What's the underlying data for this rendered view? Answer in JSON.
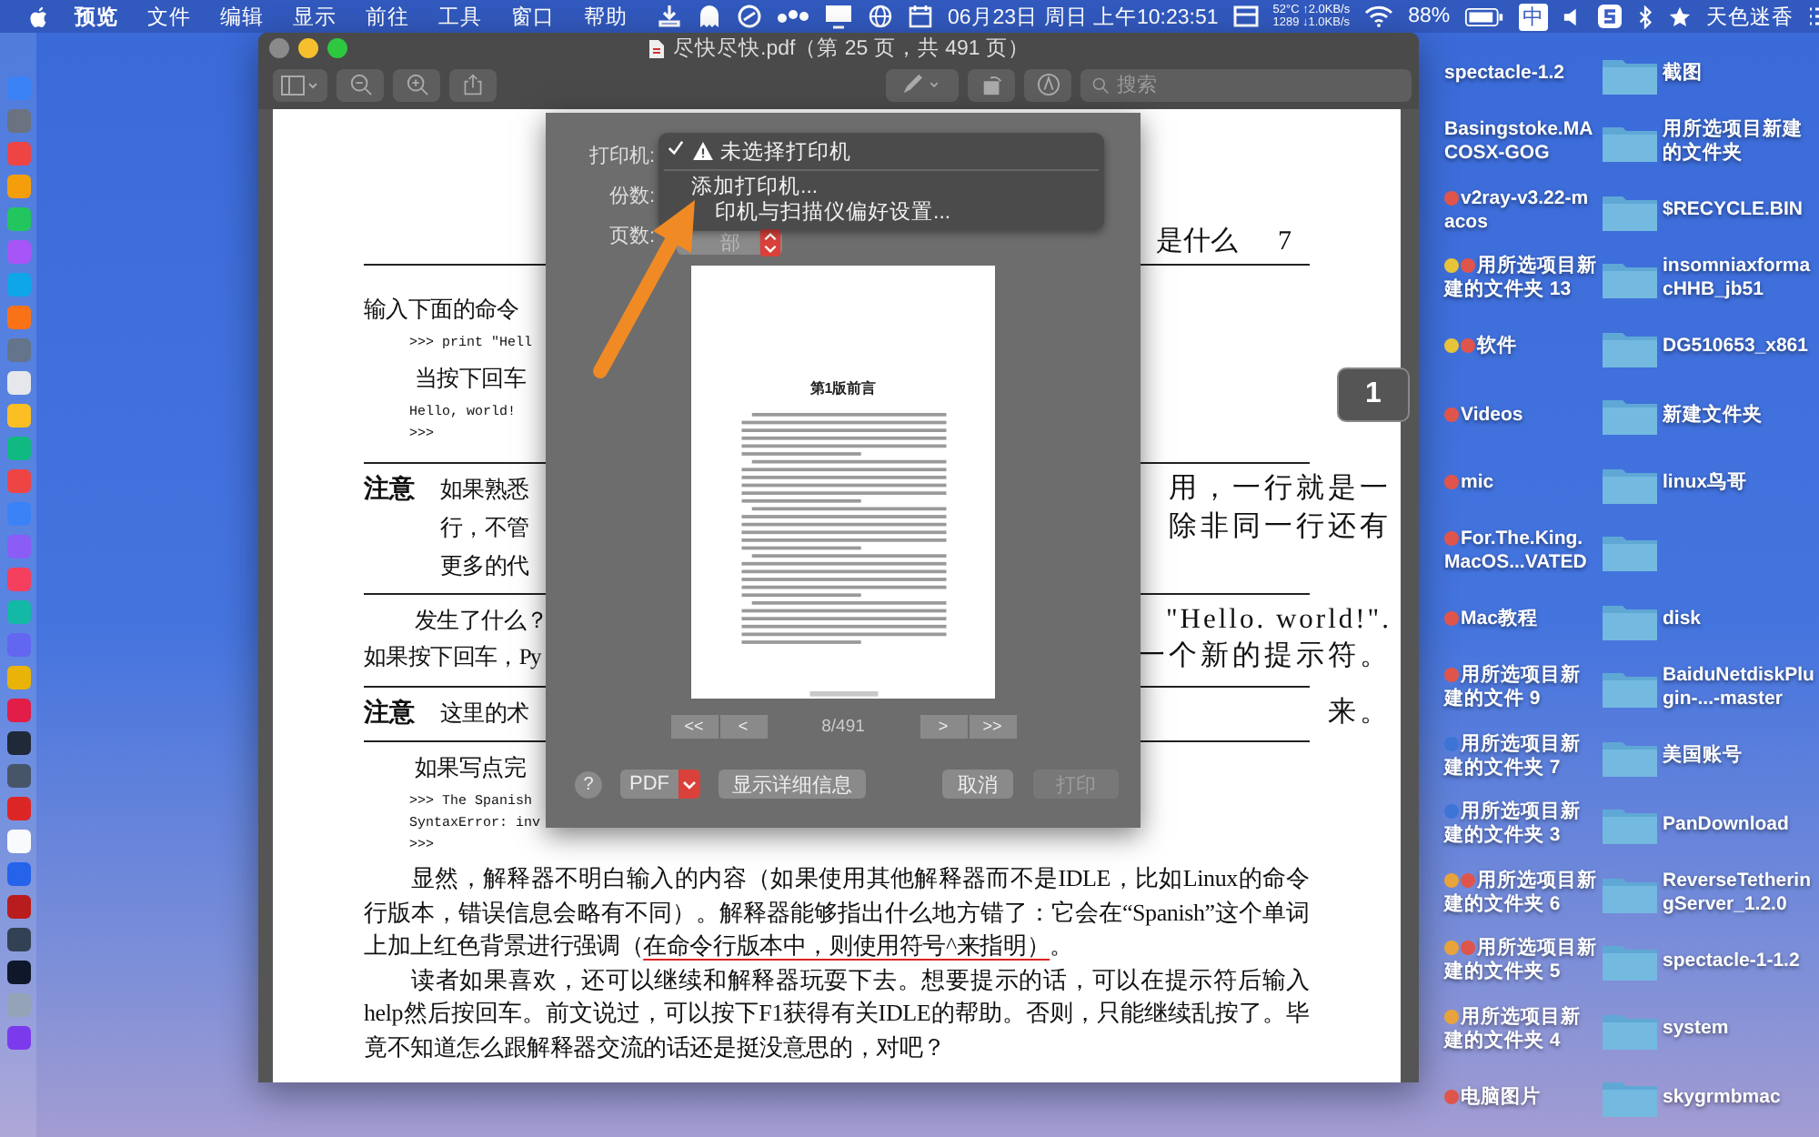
{
  "menubar": {
    "app": "预览",
    "menus": [
      "文件",
      "编辑",
      "显示",
      "前往",
      "工具",
      "窗口",
      "帮助"
    ],
    "clock": "06月23日 周日 上午10:23:51",
    "net_top": "52°C ↑2.0KB/s",
    "net_bottom": "1289 ↓1.0KB/s",
    "battery": "88%",
    "input_method": "中",
    "user": "天色迷香"
  },
  "window": {
    "title": "尽快尽快.pdf（第 25 页，共 491 页）",
    "search_placeholder": "搜索",
    "page_badge": "1"
  },
  "document": [
    {
      "kind": "header",
      "right": "是什么",
      "page": "7"
    },
    {
      "kind": "text",
      "indent": false,
      "left": "输入下面的命令"
    },
    {
      "kind": "code",
      "lines": [
        ">>> print \"Hell"
      ]
    },
    {
      "kind": "text",
      "indent": true,
      "left": "当按下回车"
    },
    {
      "kind": "code",
      "lines": [
        "Hello, world!",
        ">>>"
      ]
    },
    {
      "kind": "note",
      "label": "注意",
      "lines": [
        {
          "left": "如果熟悉",
          "right": "用，一行就是一"
        },
        {
          "left": "行，不管",
          "right": "除非同一行还有"
        },
        {
          "left": "更多的代"
        }
      ]
    },
    {
      "kind": "text",
      "indent": true,
      "left": "发生了什么？",
      "right": "\"Hello. world!\"."
    },
    {
      "kind": "text",
      "indent": false,
      "left": "如果按下回车，Py",
      "right": "一个新的提示符。"
    },
    {
      "kind": "note",
      "label": "注意",
      "lines": [
        {
          "left": "这里的术",
          "right": "来。"
        }
      ]
    },
    {
      "kind": "text",
      "indent": true,
      "left": "如果写点完"
    },
    {
      "kind": "code",
      "lines": [
        ">>> The Spanish",
        "SyntaxError: inv",
        ">>>"
      ]
    },
    {
      "kind": "para",
      "before": "显然，解释器不明白输入的内容（如果使用其他解释器而不是IDLE，比如Linux的命令行版本，错误信息会略有不同）。解释器能够指出什么地方错了：它会在“Spanish”这个单词上加上红色背景进行强调（",
      "underlined": "在命令行版本中，则使用符号^来指明）",
      "after": "。"
    },
    {
      "kind": "para",
      "before": "读者如果喜欢，还可以继续和解释器玩耍下去。想要提示的话，可以在提示符后输入help然后按回车。前文说过，可以按下F1获得有关IDLE的帮助。否则，只能继续乱按了。毕竟不知道怎么跟解释器交流的话还是挺没意思的，对吧？"
    }
  ],
  "print_sheet": {
    "printer_label": "打印机:",
    "current_printer": {
      "label": "未选择打印机",
      "checked": true,
      "warning": true
    },
    "menu_actions": [
      "添加打印机...",
      "印机与扫描仪偏好设置..."
    ],
    "copies_label": "份数:",
    "pages_label": "页数:",
    "pages_value": "部",
    "preview_heading": "第1版前言",
    "page_indicator": "8/491",
    "nav_back": [
      "<<",
      "<"
    ],
    "nav_forward": [
      ">",
      ">>"
    ],
    "help": "?",
    "pdf": "PDF",
    "details": "显示详细信息",
    "cancel": "取消",
    "print": {
      "label": "打印",
      "disabled": true
    }
  },
  "desktop_left": [
    {
      "label": "spectacle-1.2"
    },
    {
      "label": "Basingstoke.MACOSX-GOG"
    },
    {
      "label": "v2ray-v3.22-macos",
      "tags": [
        {
          "color": "#e0554b"
        }
      ]
    },
    {
      "label": "用所选项目新建的文件夹 13",
      "tags": [
        {
          "color": "#e6c43a"
        },
        {
          "color": "#e0554b"
        }
      ]
    },
    {
      "label": "软件",
      "tags": [
        {
          "color": "#e6c43a"
        },
        {
          "color": "#e0554b"
        }
      ]
    },
    {
      "label": "Videos",
      "tags": [
        {
          "color": "#e0554b"
        }
      ]
    },
    {
      "label": "mic",
      "tags": [
        {
          "color": "#e0554b"
        }
      ]
    },
    {
      "label": "For.The.King.MacOS...VATED",
      "tags": [
        {
          "color": "#e0554b"
        }
      ]
    },
    {
      "label": "Mac教程",
      "tags": [
        {
          "color": "#e0554b"
        }
      ]
    },
    {
      "label": "用所选项目新建的文件 9",
      "tags": [
        {
          "color": "#e0554b"
        }
      ]
    },
    {
      "label": "用所选项目新建的文件夹 7",
      "tags": [
        {
          "color": "#3d74d6"
        }
      ]
    },
    {
      "label": "用所选项目新建的文件夹 3",
      "tags": [
        {
          "color": "#3d74d6"
        }
      ]
    },
    {
      "label": "用所选项目新建的文件夹 6",
      "tags": [
        {
          "color": "#e8a33c"
        },
        {
          "color": "#e0554b"
        }
      ]
    },
    {
      "label": "用所选项目新建的文件夹 5",
      "tags": [
        {
          "color": "#e8a33c"
        },
        {
          "color": "#e0554b"
        }
      ]
    },
    {
      "label": "用所选项目新建的文件夹 4",
      "tags": [
        {
          "color": "#e8a33c"
        }
      ]
    },
    {
      "label": "电脑图片",
      "tags": [
        {
          "color": "#e0554b"
        }
      ]
    }
  ],
  "desktop_right": [
    {
      "kind": "folder",
      "label": "截图"
    },
    {
      "kind": "folder",
      "label": "用所选项目新建的文件夹"
    },
    {
      "kind": "folder",
      "label": "$RECYCLE.BIN"
    },
    {
      "kind": "folder",
      "label": "insomniaxformacHHB_jb51"
    },
    {
      "kind": "folder",
      "label": "DG510653_x861"
    },
    {
      "kind": "folder",
      "label": "新建文件夹"
    },
    {
      "kind": "folder",
      "label": "linux鸟哥"
    },
    {
      "kind": "folder"
    },
    {
      "kind": "folder",
      "label": "disk"
    },
    {
      "kind": "folder",
      "label": "BaiduNetdiskPlugin-...-master"
    },
    {
      "kind": "folder",
      "label": "美国账号"
    },
    {
      "kind": "folder",
      "label": "PanDownload"
    },
    {
      "kind": "folder",
      "label": "ReverseTetheringServer_1.2.0"
    },
    {
      "kind": "folder",
      "label": "spectacle-1-1.2"
    },
    {
      "kind": "folder",
      "label": "system"
    },
    {
      "kind": "folder",
      "label": "skygrmbmac"
    }
  ]
}
